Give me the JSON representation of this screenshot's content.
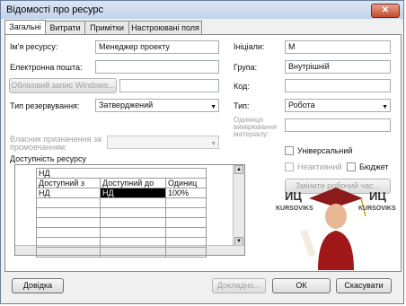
{
  "window": {
    "title": "Відомості про ресурс",
    "close_label": "✕"
  },
  "tabs": [
    "Загальні",
    "Витрати",
    "Примітки",
    "Настроювані поля"
  ],
  "fields": {
    "resource_name_label": "Ім'я ресурсу:",
    "resource_name_value": "Менеджер проекту",
    "email_label": "Електронна пошта:",
    "email_value": "",
    "windows_account_button": "Обліковий запис Windows...",
    "windows_account_value": "",
    "booking_type_label": "Тип резервування:",
    "booking_type_value": "Затверджений",
    "default_assignment_owner_label": "Власник призначення за промовчанням:",
    "default_assignment_owner_value": "",
    "initials_label": "Ініціали:",
    "initials_value": "М",
    "group_label": "Група:",
    "group_value": "Внутрішній",
    "code_label": "Код:",
    "code_value": "",
    "type_label": "Тип:",
    "type_value": "Робота",
    "material_units_label": "Одиниця вимірювання матеріалу:",
    "material_units_value": ""
  },
  "checkboxes": {
    "generic_label": "Універсальний",
    "inactive_label": "Неактивний",
    "budget_label": "Бюджет"
  },
  "change_calendar_button": "Змінити робочий час...",
  "availability": {
    "label": "Доступність ресурсу",
    "edit_value": "НД",
    "headers": [
      "Доступний з",
      "Доступний до",
      "Одиниц"
    ],
    "rows": [
      [
        "НД",
        "НД",
        "100%"
      ],
      [
        "",
        "",
        ""
      ],
      [
        "",
        "",
        ""
      ],
      [
        "",
        "",
        ""
      ],
      [
        "",
        "",
        ""
      ],
      [
        "",
        "",
        ""
      ],
      [
        "",
        "",
        ""
      ]
    ]
  },
  "footer": {
    "help_button": "Довідка",
    "details_button": "Докладно...",
    "ok_button": "ОК",
    "cancel_button": "Скасувати"
  },
  "watermark": {
    "left_text": "ИЦ",
    "right_text": "ИЦ",
    "brand_left": "KURSOVIKS",
    "brand_right": "KURSOVIKS"
  }
}
